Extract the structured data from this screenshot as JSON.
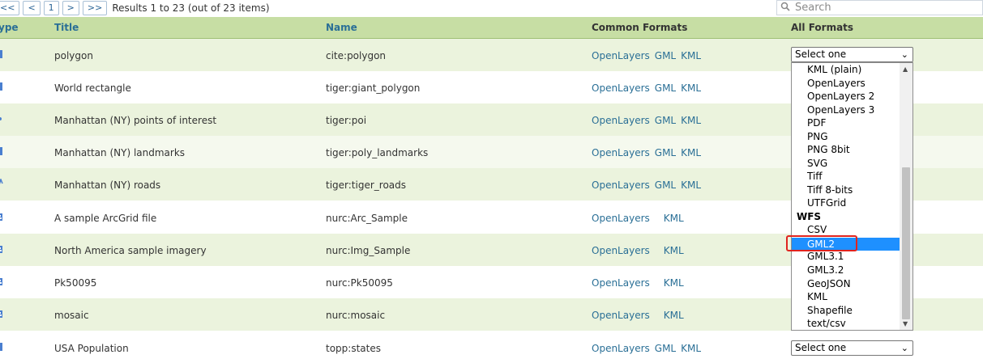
{
  "pager": {
    "first": "<<",
    "prev": "<",
    "page": "1",
    "next": ">",
    "last": ">>",
    "results": "Results 1 to 23 (out of 23 items)"
  },
  "search": {
    "placeholder": "Search"
  },
  "columns": {
    "type": "ype",
    "title": "Title",
    "name": "Name",
    "common": "Common Formats",
    "all": "All Formats"
  },
  "rows": [
    {
      "title": "polygon",
      "name": "cite:polygon",
      "f1": "OpenLayers",
      "f2": "GML",
      "f3": "KML",
      "select": "Select one"
    },
    {
      "title": "World rectangle",
      "name": "tiger:giant_polygon",
      "f1": "OpenLayers",
      "f2": "GML",
      "f3": "KML"
    },
    {
      "title": "Manhattan (NY) points of interest",
      "name": "tiger:poi",
      "f1": "OpenLayers",
      "f2": "GML",
      "f3": "KML"
    },
    {
      "title": "Manhattan (NY) landmarks",
      "name": "tiger:poly_landmarks",
      "f1": "OpenLayers",
      "f2": "GML",
      "f3": "KML"
    },
    {
      "title": "Manhattan (NY) roads",
      "name": "tiger:tiger_roads",
      "f1": "OpenLayers",
      "f2": "GML",
      "f3": "KML"
    },
    {
      "title": "A sample ArcGrid file",
      "name": "nurc:Arc_Sample",
      "f1": "OpenLayers",
      "f3": "KML"
    },
    {
      "title": "North America sample imagery",
      "name": "nurc:Img_Sample",
      "f1": "OpenLayers",
      "f3": "KML"
    },
    {
      "title": "Pk50095",
      "name": "nurc:Pk50095",
      "f1": "OpenLayers",
      "f3": "KML"
    },
    {
      "title": "mosaic",
      "name": "nurc:mosaic",
      "f1": "OpenLayers",
      "f3": "KML"
    },
    {
      "title": "USA Population",
      "name": "topp:states",
      "f1": "OpenLayers",
      "f2": "GML",
      "f3": "KML",
      "select": "Select one"
    }
  ],
  "dropdown": {
    "options_a": [
      "KML (plain)",
      "OpenLayers",
      "OpenLayers 2",
      "OpenLayers 3",
      "PDF",
      "PNG",
      "PNG 8bit",
      "SVG",
      "Tiff",
      "Tiff 8-bits",
      "UTFGrid"
    ],
    "group": "WFS",
    "options_b": [
      "CSV",
      "GML2",
      "GML3.1",
      "GML3.2",
      "GeoJSON",
      "KML",
      "Shapefile",
      "text/csv"
    ],
    "highlighted": "GML2"
  },
  "colors": {
    "header_bg": "#c7dea4",
    "alt_row": "#ebf3dd",
    "link": "#2a6f96",
    "highlight": "#1e90ff",
    "annotation": "#e0241f"
  },
  "icons": {
    "search": "search-icon",
    "layer_type": "layer-type-icon",
    "dropdown": "chevron-down-icon"
  }
}
